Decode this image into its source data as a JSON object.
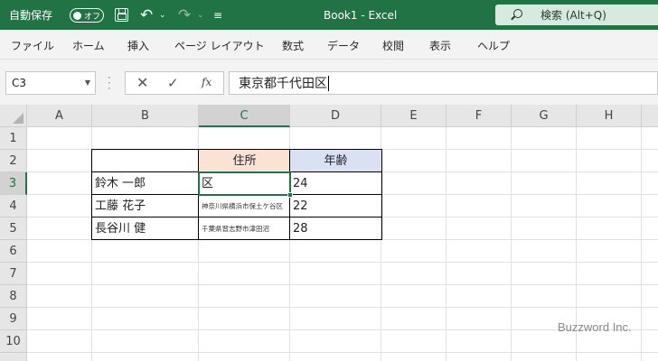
{
  "titlebar": {
    "autosave_label": "自動保存",
    "autosave_state": "オフ",
    "undo_glyph": "↶",
    "redo_glyph": "↷",
    "dropdown_glyph": "⌄",
    "qat_more_glyph": "≡",
    "doc_title": "Book1  -  Excel",
    "search_placeholder": "検索 (Alt+Q)",
    "bg_color": "#217346"
  },
  "ribbon": {
    "tabs": [
      "ファイル",
      "ホーム",
      "挿入",
      "ページ レイアウト",
      "数式",
      "データ",
      "校閲",
      "表示",
      "ヘルプ"
    ]
  },
  "formula_bar": {
    "name_box": "C3",
    "cancel_glyph": "✕",
    "enter_glyph": "✓",
    "fx_label": "fx",
    "content": "東京都千代田区"
  },
  "sheet": {
    "columns": [
      "A",
      "B",
      "C",
      "D",
      "E",
      "F",
      "G",
      "H"
    ],
    "rows": [
      "1",
      "2",
      "3",
      "4",
      "5",
      "6",
      "7",
      "8",
      "9",
      "10"
    ],
    "selected_cell": "C3",
    "header_jusho": "住所",
    "header_nenrei": "年齢",
    "data_rows": [
      {
        "name": "鈴木 一郎",
        "address": "区",
        "age": "24"
      },
      {
        "name": "工藤 花子",
        "address": "神奈川県横浜市保土ケ谷区",
        "age": "22"
      },
      {
        "name": "長谷川 健",
        "address": "千葉県習志野市津田沼",
        "age": "28"
      }
    ],
    "jusho_fill": "#fbe2d5",
    "nenrei_fill": "#d9e1f2"
  },
  "watermark": "Buzzword Inc."
}
